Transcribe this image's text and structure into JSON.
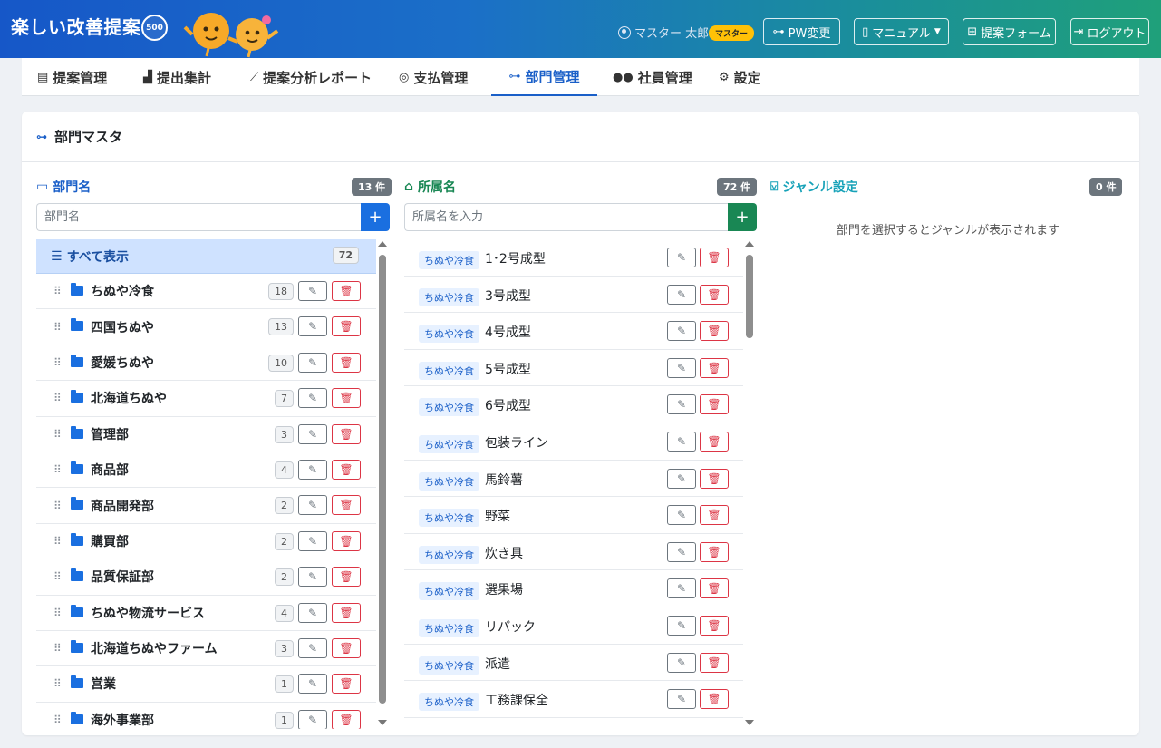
{
  "header": {
    "brand": "楽しい改善提案",
    "badge": "500",
    "user_name": "マスター 太郎",
    "role": "マスター",
    "buttons": [
      {
        "label": "PW変更",
        "icon": "key-icon"
      },
      {
        "label": "マニュアル",
        "icon": "book-icon"
      },
      {
        "label": "提案フォーム",
        "icon": "file-plus-icon"
      },
      {
        "label": "ログアウト",
        "icon": "logout-icon"
      }
    ]
  },
  "nav": {
    "items": [
      {
        "label": "提案管理",
        "icon": "document-icon"
      },
      {
        "label": "提出集計",
        "icon": "bar-chart-icon"
      },
      {
        "label": "提案分析レポート",
        "icon": "line-chart-icon"
      },
      {
        "label": "支払管理",
        "icon": "coin-icon"
      },
      {
        "label": "部門管理",
        "icon": "org-icon"
      },
      {
        "label": "社員管理",
        "icon": "people-icon"
      },
      {
        "label": "設定",
        "icon": "gear-icon"
      }
    ],
    "active": "部門管理"
  },
  "card": {
    "title": "部門マスタ"
  },
  "departments": {
    "title": "部門名",
    "count_label": "13 件",
    "placeholder": "部門名",
    "all_label": "すべて表示",
    "all_count": "72",
    "items": [
      {
        "name": "ちぬや冷食",
        "count": "18"
      },
      {
        "name": "四国ちぬや",
        "count": "13"
      },
      {
        "name": "愛媛ちぬや",
        "count": "10"
      },
      {
        "name": "北海道ちぬや",
        "count": "7"
      },
      {
        "name": "管理部",
        "count": "3"
      },
      {
        "name": "商品部",
        "count": "4"
      },
      {
        "name": "商品開発部",
        "count": "2"
      },
      {
        "name": "購買部",
        "count": "2"
      },
      {
        "name": "品質保証部",
        "count": "2"
      },
      {
        "name": "ちぬや物流サービス",
        "count": "4"
      },
      {
        "name": "北海道ちぬやファーム",
        "count": "3"
      },
      {
        "name": "営業",
        "count": "1"
      },
      {
        "name": "海外事業部",
        "count": "1"
      }
    ]
  },
  "affiliations": {
    "title": "所属名",
    "count_label": "72 件",
    "placeholder": "所属名を入力",
    "items": [
      {
        "tag": "ちぬや冷食",
        "name": "1･2号成型"
      },
      {
        "tag": "ちぬや冷食",
        "name": "3号成型"
      },
      {
        "tag": "ちぬや冷食",
        "name": "4号成型"
      },
      {
        "tag": "ちぬや冷食",
        "name": "5号成型"
      },
      {
        "tag": "ちぬや冷食",
        "name": "6号成型"
      },
      {
        "tag": "ちぬや冷食",
        "name": "包装ライン"
      },
      {
        "tag": "ちぬや冷食",
        "name": "馬鈴薯"
      },
      {
        "tag": "ちぬや冷食",
        "name": "野菜"
      },
      {
        "tag": "ちぬや冷食",
        "name": "炊き具"
      },
      {
        "tag": "ちぬや冷食",
        "name": "選果場"
      },
      {
        "tag": "ちぬや冷食",
        "name": "リパック"
      },
      {
        "tag": "ちぬや冷食",
        "name": "派遣"
      },
      {
        "tag": "ちぬや冷食",
        "name": "工務課保全"
      }
    ]
  },
  "genres": {
    "title": "ジャンル設定",
    "count_label": "0 件",
    "empty_message": "部門を選択するとジャンルが表示されます"
  },
  "colors": {
    "primary": "#1a5fc8",
    "success": "#198754",
    "danger": "#dc3545",
    "teal": "#17a2b8",
    "warning": "#ffc107"
  }
}
